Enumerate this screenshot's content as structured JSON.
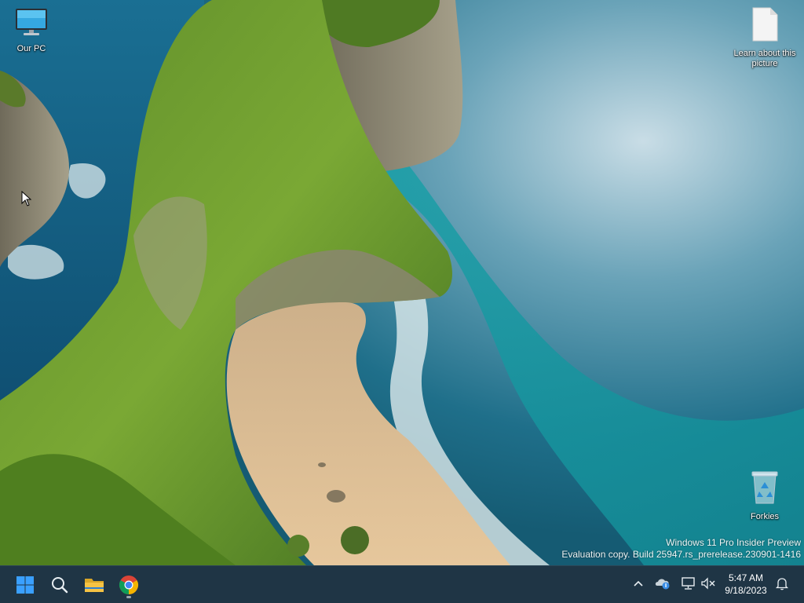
{
  "desktop": {
    "icons": [
      {
        "label": "Our PC",
        "icon": "monitor-icon"
      },
      {
        "label": "Learn about this picture",
        "icon": "document-icon"
      },
      {
        "label": "Forkies",
        "icon": "recycle-bin-icon"
      }
    ],
    "watermark": {
      "line1": "Windows 11 Pro Insider Preview",
      "line2": "Evaluation copy. Build 25947.rs_prerelease.230901-1416"
    }
  },
  "taskbar": {
    "pinned": [
      {
        "name": "Start",
        "icon": "windows-logo-icon"
      },
      {
        "name": "Search",
        "icon": "search-icon"
      },
      {
        "name": "File Explorer",
        "icon": "folder-icon"
      },
      {
        "name": "Google Chrome",
        "icon": "chrome-icon"
      }
    ],
    "tray": {
      "icons": [
        "chevron-up-icon",
        "onedrive-icon",
        "network-icon",
        "volume-muted-icon",
        "bell-icon"
      ],
      "time": "5:47 AM",
      "date": "9/18/2023"
    }
  },
  "colors": {
    "taskbar_bg": "#1f3545",
    "start_blue": "#3aa0ff",
    "folder_yellow": "#f6c343"
  }
}
